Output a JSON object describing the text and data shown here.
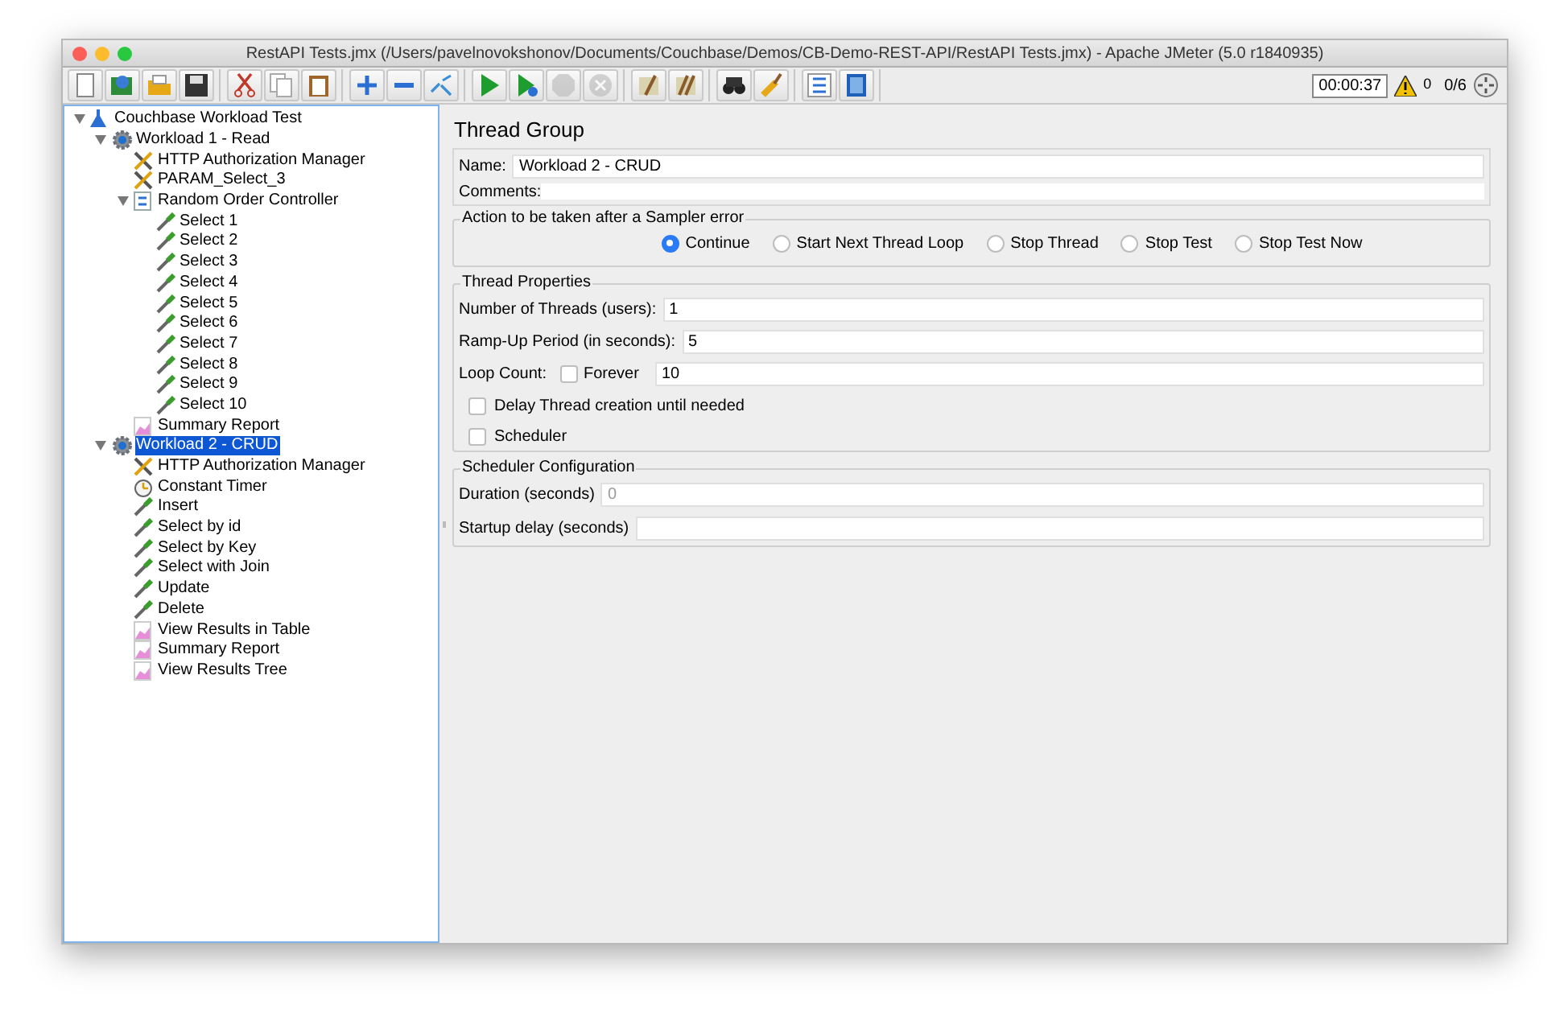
{
  "window": {
    "title": "RestAPI Tests.jmx (/Users/pavelnovokshonov/Documents/Couchbase/Demos/CB-Demo-REST-API/RestAPI Tests.jmx) - Apache JMeter (5.0 r1840935)"
  },
  "toolbar": [
    [
      {
        "kind": "new",
        "disabled": false
      },
      {
        "kind": "templates",
        "disabled": false
      },
      {
        "kind": "open",
        "disabled": false
      },
      {
        "kind": "save",
        "disabled": false
      }
    ],
    [
      {
        "kind": "cut",
        "disabled": false
      },
      {
        "kind": "copy",
        "disabled": false
      },
      {
        "kind": "paste",
        "disabled": false
      }
    ],
    [
      {
        "kind": "expand",
        "disabled": false
      },
      {
        "kind": "collapse",
        "disabled": false
      },
      {
        "kind": "toggle",
        "disabled": false
      }
    ],
    [
      {
        "kind": "start",
        "disabled": false
      },
      {
        "kind": "start-no-pause",
        "disabled": false
      },
      {
        "kind": "stop",
        "disabled": true
      },
      {
        "kind": "shutdown",
        "disabled": true
      }
    ],
    [
      {
        "kind": "clear",
        "disabled": false
      },
      {
        "kind": "clear-all",
        "disabled": false
      }
    ],
    [
      {
        "kind": "search",
        "disabled": false
      },
      {
        "kind": "reset-search",
        "disabled": false
      }
    ],
    [
      {
        "kind": "function",
        "disabled": false
      },
      {
        "kind": "help",
        "disabled": false
      }
    ]
  ],
  "status": {
    "elapsed": "00:00:37",
    "warnings": "0",
    "threads": "0/6"
  },
  "tree": [
    {
      "label": "Couchbase Workload Test",
      "kind": "plan",
      "expanded": true,
      "selected": false,
      "children": [
        {
          "label": "Workload 1 - Read",
          "kind": "group",
          "expanded": true,
          "selected": false,
          "children": [
            {
              "label": "HTTP Authorization Manager",
              "kind": "config",
              "selected": false
            },
            {
              "label": "PARAM_Select_3",
              "kind": "config",
              "selected": false
            },
            {
              "label": "Random Order Controller",
              "kind": "controller",
              "expanded": true,
              "selected": false,
              "children": [
                {
                  "label": "Select 1",
                  "kind": "sampler",
                  "selected": false
                },
                {
                  "label": "Select 2",
                  "kind": "sampler",
                  "selected": false
                },
                {
                  "label": "Select 3",
                  "kind": "sampler",
                  "selected": false
                },
                {
                  "label": "Select 4",
                  "kind": "sampler",
                  "selected": false
                },
                {
                  "label": "Select 5",
                  "kind": "sampler",
                  "selected": false
                },
                {
                  "label": "Select 6",
                  "kind": "sampler",
                  "selected": false
                },
                {
                  "label": "Select 7",
                  "kind": "sampler",
                  "selected": false
                },
                {
                  "label": "Select 8",
                  "kind": "sampler",
                  "selected": false
                },
                {
                  "label": "Select 9",
                  "kind": "sampler",
                  "selected": false
                },
                {
                  "label": "Select 10",
                  "kind": "sampler",
                  "selected": false
                }
              ]
            },
            {
              "label": "Summary Report",
              "kind": "listener",
              "selected": false
            }
          ]
        },
        {
          "label": "Workload 2 - CRUD",
          "kind": "group",
          "expanded": true,
          "selected": true,
          "children": [
            {
              "label": "HTTP Authorization Manager",
              "kind": "config",
              "selected": false
            },
            {
              "label": "Constant Timer",
              "kind": "timer",
              "selected": false
            },
            {
              "label": "Insert",
              "kind": "sampler",
              "selected": false
            },
            {
              "label": "Select by id",
              "kind": "sampler",
              "selected": false
            },
            {
              "label": "Select by Key",
              "kind": "sampler",
              "selected": false
            },
            {
              "label": "Select with Join",
              "kind": "sampler",
              "selected": false
            },
            {
              "label": "Update",
              "kind": "sampler",
              "selected": false
            },
            {
              "label": "Delete",
              "kind": "sampler",
              "selected": false
            },
            {
              "label": "View Results in Table",
              "kind": "listener",
              "selected": false
            },
            {
              "label": "Summary Report",
              "kind": "listener",
              "selected": false
            },
            {
              "label": "View Results Tree",
              "kind": "listener",
              "selected": false
            }
          ]
        }
      ]
    }
  ],
  "panel": {
    "title": "Thread Group",
    "name_label": "Name:",
    "name_value": "Workload 2 - CRUD",
    "comments_label": "Comments:",
    "error_action": {
      "legend": "Action to be taken after a Sampler error",
      "options": [
        {
          "label": "Continue",
          "selected": true
        },
        {
          "label": "Start Next Thread Loop",
          "selected": false
        },
        {
          "label": "Stop Thread",
          "selected": false
        },
        {
          "label": "Stop Test",
          "selected": false
        },
        {
          "label": "Stop Test Now",
          "selected": false
        }
      ]
    },
    "thread_properties": {
      "legend": "Thread Properties",
      "threads_label": "Number of Threads (users):",
      "threads_value": "1",
      "rampup_label": "Ramp-Up Period (in seconds):",
      "rampup_value": "5",
      "loop_label": "Loop Count:",
      "forever": {
        "label": "Forever",
        "checked": false
      },
      "loop_value": "10",
      "delay": {
        "label": "Delay Thread creation until needed",
        "checked": false
      },
      "scheduler": {
        "label": "Scheduler",
        "checked": false
      }
    },
    "scheduler_config": {
      "legend": "Scheduler Configuration",
      "duration_label": "Duration (seconds)",
      "duration_value": "0",
      "duration_disabled": true,
      "startup_label": "Startup delay (seconds)"
    }
  }
}
